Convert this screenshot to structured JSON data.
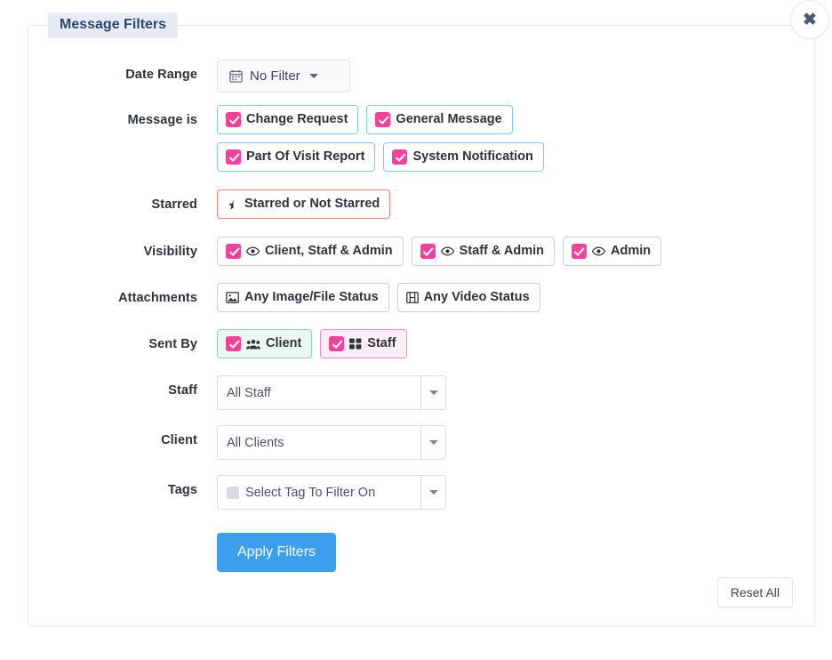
{
  "panel": {
    "title": "Message Filters",
    "close_label": "✖",
    "accent_blue": "#3c9fed",
    "accent_pink": "#f0429a",
    "tab_text_color": "#2f4674"
  },
  "rows": {
    "date_range": {
      "label": "Date Range",
      "button": {
        "icon": "calendar-icon",
        "text": "No Filter"
      }
    },
    "message_is": {
      "label": "Message is",
      "options": [
        {
          "text": "Change Request",
          "checked": true,
          "style": "blue"
        },
        {
          "text": "General Message",
          "checked": true,
          "style": "blue"
        },
        {
          "text": "Part Of Visit Report",
          "checked": true,
          "style": "blue"
        },
        {
          "text": "System Notification",
          "checked": true,
          "style": "blue"
        }
      ]
    },
    "starred": {
      "label": "Starred",
      "options": [
        {
          "text": "Starred or Not Starred",
          "checked": false,
          "style": "red",
          "icon": "star-half-icon"
        }
      ]
    },
    "visibility": {
      "label": "Visibility",
      "options": [
        {
          "text": "Client, Staff & Admin",
          "checked": true,
          "style": "gray",
          "icon": "eye-icon"
        },
        {
          "text": "Staff & Admin",
          "checked": true,
          "style": "gray",
          "icon": "eye-icon"
        },
        {
          "text": "Admin",
          "checked": true,
          "style": "gray",
          "icon": "eye-icon"
        }
      ]
    },
    "attachments": {
      "label": "Attachments",
      "options": [
        {
          "text": "Any Image/File Status",
          "checked": false,
          "style": "gray",
          "icon": "image-icon"
        },
        {
          "text": "Any Video Status",
          "checked": false,
          "style": "gray",
          "icon": "film-icon"
        }
      ]
    },
    "sent_by": {
      "label": "Sent By",
      "options": [
        {
          "text": "Client",
          "checked": true,
          "style": "green",
          "icon": "users-icon"
        },
        {
          "text": "Staff",
          "checked": true,
          "style": "pink",
          "icon": "grid-icon"
        }
      ]
    },
    "staff": {
      "label": "Staff",
      "select": {
        "value": "All Staff",
        "arrow": "caret-down-icon"
      }
    },
    "client": {
      "label": "Client",
      "select": {
        "value": "All Clients",
        "arrow": "caret-down-icon"
      }
    },
    "tags": {
      "label": "Tags",
      "select": {
        "value": "Select Tag To Filter On",
        "arrow": "caret-down-icon",
        "swatch": "tag-color-swatch"
      }
    }
  },
  "actions": {
    "apply_label": "Apply Filters",
    "reset_label": "Reset All"
  }
}
